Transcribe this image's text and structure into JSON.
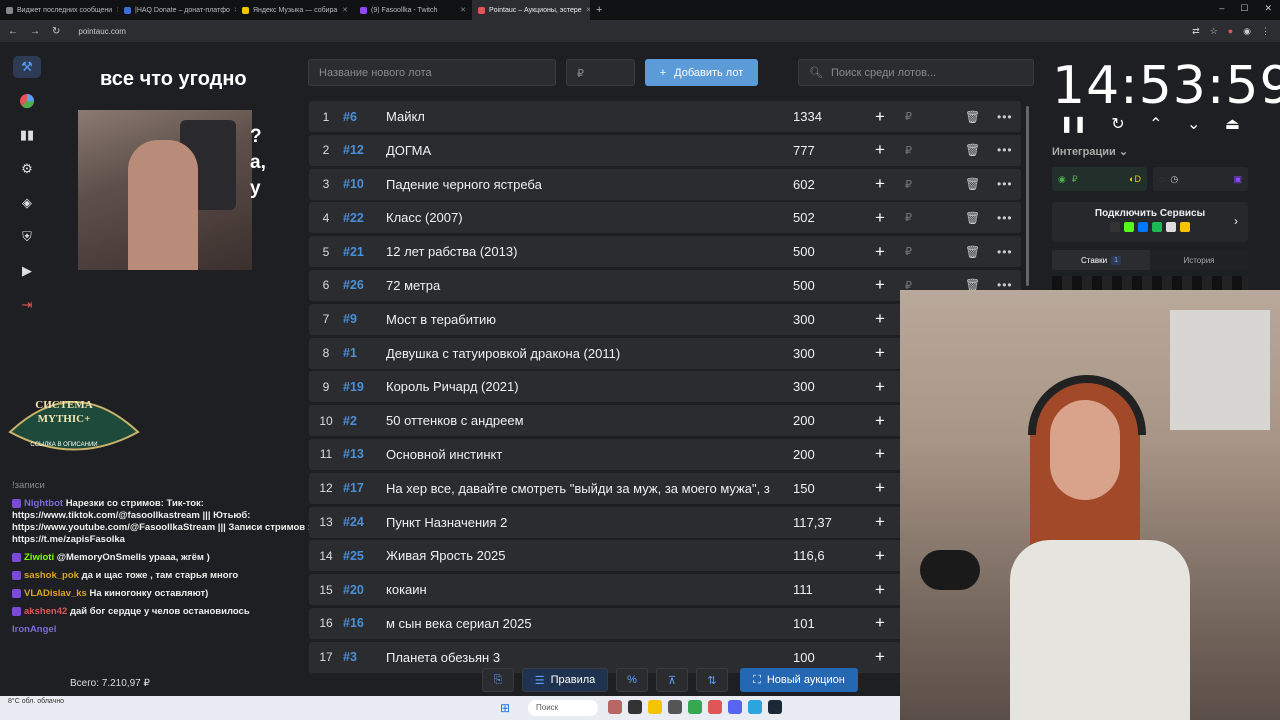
{
  "browser": {
    "tabs": [
      {
        "label": "Виджет последних сообщени"
      },
      {
        "label": "|HAQ Donate – донат-платфо"
      },
      {
        "label": "Яндекс Музыка — собира"
      },
      {
        "label": "(9) Fasoollka - Twitch"
      },
      {
        "label": "Pointauc – Аукционы, эстере",
        "active": true
      }
    ],
    "new_tab": "+",
    "url": "pointauc.com",
    "nav": {
      "back": "←",
      "forward": "→",
      "reload": "↻"
    },
    "window_controls": {
      "minimize": "–",
      "maximize": "☐",
      "close": "✕"
    }
  },
  "stream": {
    "title": "все что угодно",
    "side_text": [
      "?",
      "а,",
      "у"
    ],
    "mythic_badge": {
      "line1": "СИСТЕМА",
      "line2": "MYTHIC+",
      "line3": "ССЫЛКА В ОПИСАНИИ"
    },
    "chat": [
      {
        "user": "",
        "text": "!записи"
      },
      {
        "user": "Nightbot",
        "text": "Нарезки со стримов: Тик-ток: https://www.tiktok.com/@fasoollkastream ||| Ютьюб: https://www.youtube.com/@FasoollkaStream ||| Записи стримов : https://t.me/zapisFasolka"
      },
      {
        "user": "Ziwioti",
        "text": "@MemoryOnSmells урааа, жгём )"
      },
      {
        "user": "sashok_pok",
        "text": "да и щас тоже , там старья много"
      },
      {
        "user": "VLADislav_ks",
        "text": "На киногонку оставляют)"
      },
      {
        "user": "akshen42",
        "text": "дай бог сердце у челов остановилось"
      },
      {
        "user": "IronAngel",
        "text": ""
      }
    ],
    "total_label": "Всего:",
    "total_value": "7.210,97 ₽",
    "weather": "8°C обл. облачно"
  },
  "auction": {
    "lot_placeholder": "Название нового лота",
    "price_placeholder": "₽",
    "add_button": "Добавить лот",
    "search_placeholder": "Поиск среди лотов...",
    "lots": [
      {
        "n": "1",
        "id": "#6",
        "name": "Майкл",
        "amount": "1334",
        "actions": true
      },
      {
        "n": "2",
        "id": "#12",
        "name": "ДОГМА",
        "amount": "777",
        "actions": true
      },
      {
        "n": "3",
        "id": "#10",
        "name": "Падение черного ястреба",
        "amount": "602",
        "actions": true
      },
      {
        "n": "4",
        "id": "#22",
        "name": "Класс (2007)",
        "amount": "502",
        "actions": true
      },
      {
        "n": "5",
        "id": "#21",
        "name": "12 лет рабства (2013)",
        "amount": "500",
        "actions": true
      },
      {
        "n": "6",
        "id": "#26",
        "name": "72 метра",
        "amount": "500",
        "actions": true
      },
      {
        "n": "7",
        "id": "#9",
        "name": "Мост в терабитию",
        "amount": "300",
        "actions": false
      },
      {
        "n": "8",
        "id": "#1",
        "name": "Девушка с татуировкой дракона (2011)",
        "amount": "300",
        "actions": false
      },
      {
        "n": "9",
        "id": "#19",
        "name": "Король Ричард (2021)",
        "amount": "300",
        "actions": false
      },
      {
        "n": "10",
        "id": "#2",
        "name": "50 оттенков с андреем",
        "amount": "200",
        "actions": false
      },
      {
        "n": "11",
        "id": "#13",
        "name": "Основной инстинкт",
        "amount": "200",
        "actions": false
      },
      {
        "n": "12",
        "id": "#17",
        "name": "На хер все, давайте смотреть \"выйди за муж, за моего мужа\", з",
        "amount": "150",
        "actions": false
      },
      {
        "n": "13",
        "id": "#24",
        "name": "Пункт Назначения 2",
        "amount": "117,37",
        "actions": false
      },
      {
        "n": "14",
        "id": "#25",
        "name": "Живая Ярость 2025",
        "amount": "116,6",
        "actions": false
      },
      {
        "n": "15",
        "id": "#20",
        "name": "кокаин",
        "amount": "111",
        "actions": false
      },
      {
        "n": "16",
        "id": "#16",
        "name": "м сын века сериал 2025",
        "amount": "101",
        "actions": false
      },
      {
        "n": "17",
        "id": "#3",
        "name": "Планета обезьян 3",
        "amount": "100",
        "actions": false
      }
    ],
    "plus": "+",
    "rub": "₽",
    "bottom": {
      "rules": "Правила",
      "percent": "%",
      "new_auction": "Новый аукцион"
    }
  },
  "timer": {
    "time": "14:53:59",
    "integrations_label": "Интеграции",
    "connect_label": "Подключить Сервисы",
    "bets_tab": "Ставки",
    "bets_count": "1",
    "history_tab": "История"
  },
  "taskbar": {
    "search": "Поиск"
  },
  "colors": {
    "accent": "#4a90d9",
    "button": "#5b9bd8",
    "primary": "#2467b3",
    "row_bg": "#2b2c30"
  }
}
